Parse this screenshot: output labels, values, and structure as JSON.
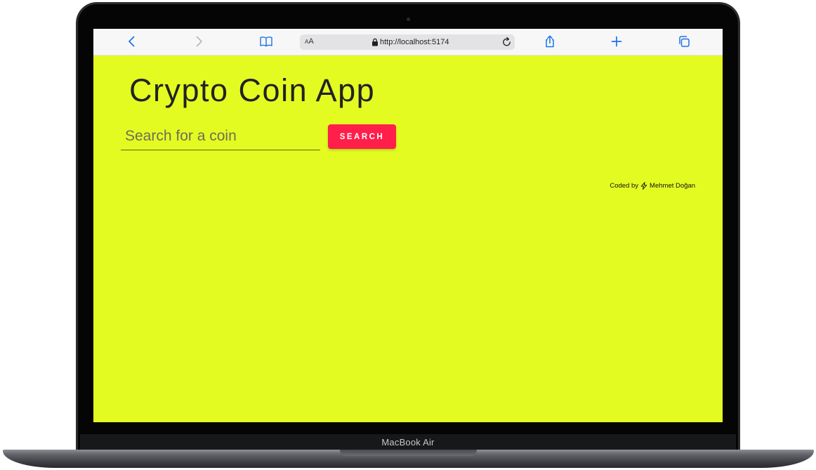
{
  "device": {
    "model_label": "MacBook Air"
  },
  "browser": {
    "text_size_label_small": "A",
    "text_size_label_large": "A",
    "url": "http://localhost:5174",
    "accent_color": "#1a73e8",
    "icons": [
      "back-arrow-icon",
      "forward-arrow-icon",
      "bookmarks-icon",
      "lock-icon",
      "reload-icon",
      "share-icon",
      "new-tab-icon",
      "tabs-icon"
    ]
  },
  "app": {
    "title": "Crypto Coin App",
    "background_color": "#e4fb22",
    "search": {
      "placeholder": "Search for a coin",
      "value": "",
      "button_label": "SEARCH",
      "button_color": "#ff1f4a"
    },
    "credit": {
      "prefix": "Coded by",
      "icon": "lightning-bolt-icon",
      "author": "Mehmet Doğan"
    }
  }
}
